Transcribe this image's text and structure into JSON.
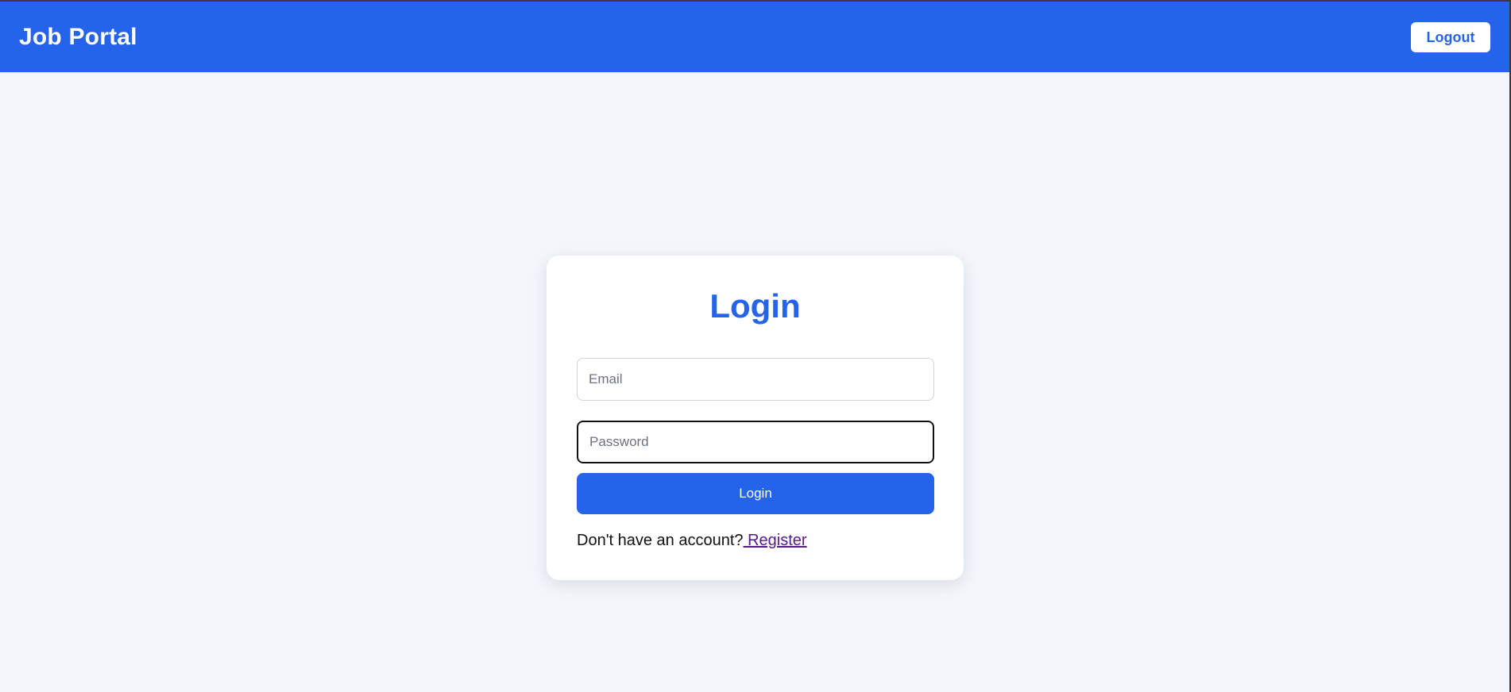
{
  "navbar": {
    "brand": "Job Portal",
    "logout_label": "Logout"
  },
  "login_card": {
    "title": "Login",
    "email": {
      "value": "",
      "placeholder": "Email"
    },
    "password": {
      "value": "",
      "placeholder": "Password"
    },
    "submit_label": "Login",
    "register_prompt": "Don't have an account?",
    "register_link": " Register"
  },
  "colors": {
    "primary": "#2563eb",
    "page_background": "#f3f6fb",
    "card_background": "#ffffff",
    "visited_link": "#551a8b"
  }
}
